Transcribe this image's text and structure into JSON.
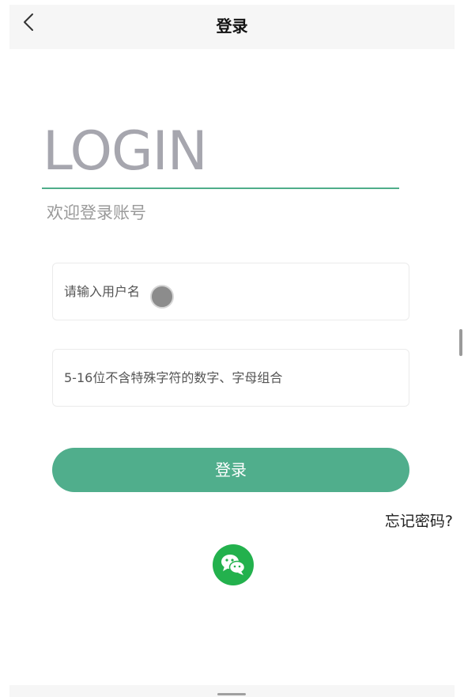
{
  "nav": {
    "title": "登录",
    "back_icon": "chevron-left-icon"
  },
  "hero": {
    "heading": "LOGIN",
    "subtitle": "欢迎登录账号"
  },
  "form": {
    "username_placeholder": "请输入用户名",
    "username_value": "",
    "password_placeholder": "5-16位不含特殊字符的数字、字母组合",
    "password_value": "",
    "submit_label": "登录",
    "forgot_label": "忘记密码?"
  },
  "social": {
    "wechat_icon": "wechat-icon"
  },
  "colors": {
    "accent": "#50ae8c",
    "heading": "#a6a6ae",
    "wechat": "#23b14d",
    "navbar_bg": "#f6f6f6"
  }
}
